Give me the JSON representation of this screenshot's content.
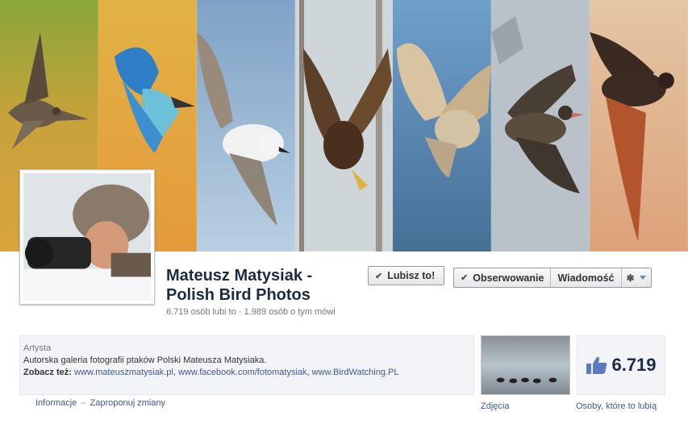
{
  "page": {
    "name": "Mateusz Matysiak - Polish Bird Photos",
    "stats": "6.719 osób lubi to · 1.989 osób o tym mówi"
  },
  "actions": {
    "like_label": "Lubisz to!",
    "follow_label": "Obserwowanie",
    "message_label": "Wiadomość"
  },
  "about": {
    "category": "Artysta",
    "description": "Autorska galeria fotografii ptaków Polski Mateusza Matysiaka.",
    "see_also_label": "Zobacz też:",
    "links": [
      "www.mateuszmatysiak.pl",
      "www.facebook.com/fotomatysiak",
      "www.BirdWatching.PL"
    ]
  },
  "info_links": [
    "Informacje",
    "Zaproponuj zmiany"
  ],
  "apps": {
    "photos_label": "Zdjęcia",
    "likes_count": "6.719",
    "likes_label": "Osoby, które to lubią"
  },
  "icons": [
    "check-icon",
    "gear-icon",
    "dropdown-caret-icon",
    "thumbs-up-icon"
  ]
}
